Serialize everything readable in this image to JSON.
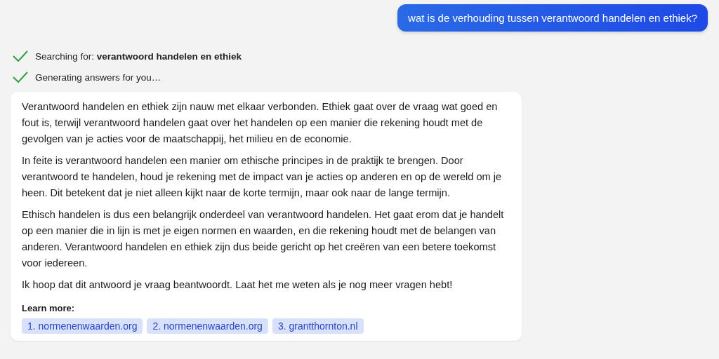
{
  "user_message": "wat is de verhouding tussen verantwoord handelen en ethiek?",
  "steps": [
    {
      "text": "Searching for: **verantwoord handelen en ethiek**",
      "done": true
    },
    {
      "text": "Generating answers for you…",
      "done": true
    }
  ],
  "answer": {
    "paragraphs": [
      "Verantwoord handelen en ethiek zijn nauw met elkaar verbonden. Ethiek gaat over de vraag wat goed en fout is, terwijl verantwoord handelen gaat over het handelen op een manier die rekening houdt met de gevolgen van je acties voor de maatschappij, het milieu en de economie.",
      "In feite is verantwoord handelen een manier om ethische principes in de praktijk te brengen. Door verantwoord te handelen, houd je rekening met de impact van je acties op anderen en op de wereld om je heen. Dit betekent dat je niet alleen kijkt naar de korte termijn, maar ook naar de lange termijn.",
      "Ethisch handelen is dus een belangrijk onderdeel van verantwoord handelen. Het gaat erom dat je handelt op een manier die in lijn is met je eigen normen en waarden, en die rekening houdt met de belangen van anderen. Verantwoord handelen en ethiek zijn dus beide gericht op het creëren van een betere toekomst voor iedereen.",
      "Ik hoop dat dit antwoord je vraag beantwoordt. Laat het me weten als je nog meer vragen hebt!"
    ],
    "learn_more_label": "Learn more:",
    "sources": [
      "1. normenenwaarden.org",
      "2. normenenwaarden.org",
      "3. grantthornton.nl"
    ]
  }
}
